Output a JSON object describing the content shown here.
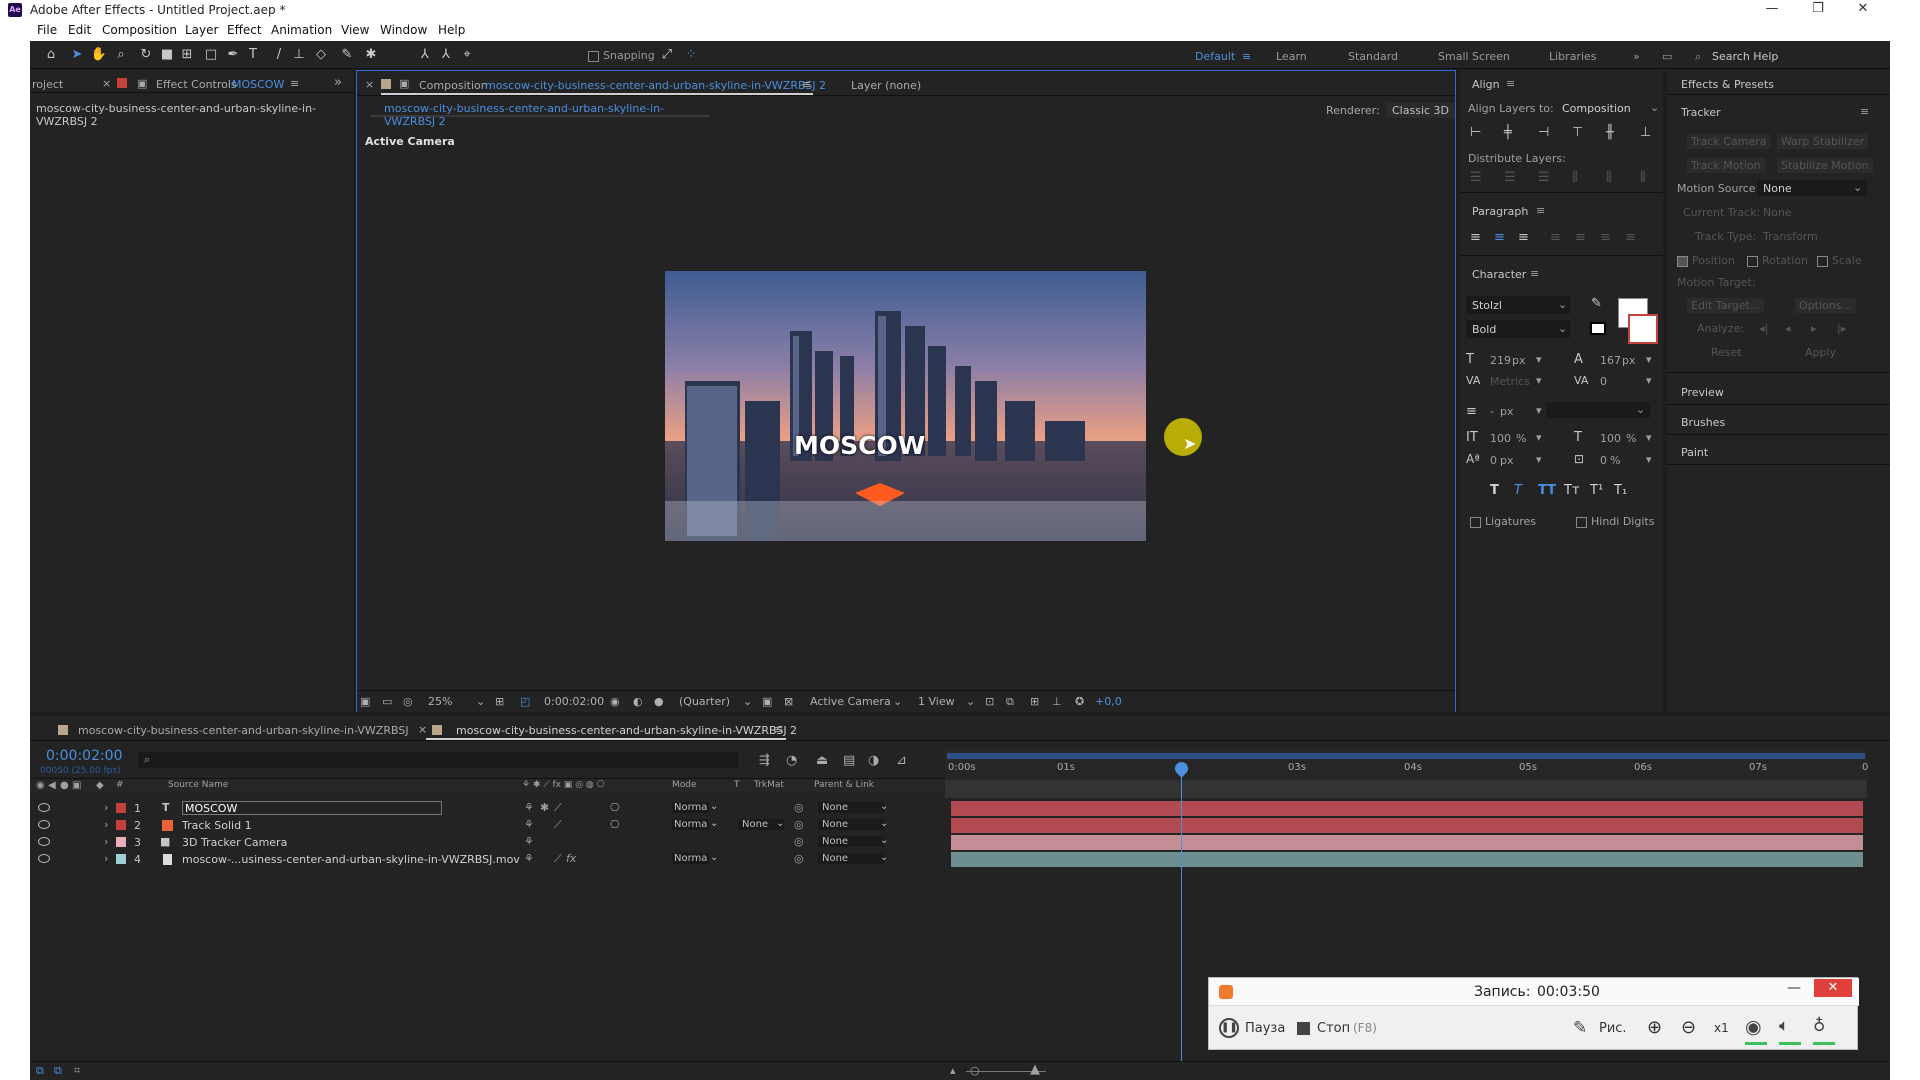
{
  "window": {
    "title": "Adobe After Effects - Untitled Project.aep *",
    "app_icon": "Ae",
    "controls": [
      "minimize-icon",
      "restore-icon",
      "close-icon"
    ]
  },
  "menu": [
    "File",
    "Edit",
    "Composition",
    "Layer",
    "Effect",
    "Animation",
    "View",
    "Window",
    "Help"
  ],
  "toolbar": {
    "snapping_label": "Snapping",
    "workspaces": [
      "Default",
      "Learn",
      "Standard",
      "Small Screen",
      "Libraries"
    ],
    "search_help": "Search Help"
  },
  "project_panel": {
    "tab_project": "roject",
    "tab_effect_controls": "Effect Controls",
    "effect_controls_layer": "MOSCOW",
    "item": "moscow-city-business-center-and-urban-skyline-in-VWZRBSJ 2"
  },
  "composition_panel": {
    "tab_prefix": "Composition",
    "comp_name": "moscow-city-business-center-and-urban-skyline-in-VWZRBSJ 2",
    "layer_tab": "Layer (none)",
    "breadcrumb": "moscow-city-business-center-and-urban-skyline-in-VWZRBSJ 2",
    "renderer_label": "Renderer:",
    "renderer_value": "Classic 3D",
    "view_label": "Active Camera",
    "overlay_text": "MOSCOW",
    "zoom": "25%",
    "timecode": "0:00:02:00",
    "resolution": "(Quarter)",
    "camera": "Active Camera",
    "views": "1 View",
    "exposure": "+0,0"
  },
  "align_panel": {
    "title": "Align",
    "align_layers_to_label": "Align Layers to:",
    "align_layers_to_value": "Composition",
    "distribute_label": "Distribute Layers:"
  },
  "paragraph_panel": {
    "title": "Paragraph"
  },
  "character_panel": {
    "title": "Character",
    "font": "Stolzl",
    "style": "Bold",
    "size": "219",
    "size_unit": "px",
    "leading": "167",
    "leading_unit": "px",
    "kerning": "Metrics",
    "tracking": "0",
    "stroke_width": "-",
    "stroke_unit": "px",
    "vertical_scale": "100",
    "horizontal_scale": "100",
    "baseline_shift": "0",
    "tsume": "0",
    "percent": "%",
    "style_buttons": [
      "T",
      "T",
      "TT",
      "Tт",
      "T¹",
      "T₁"
    ],
    "ligatures": "Ligatures",
    "hindi_digits": "Hindi Digits"
  },
  "right_panel": {
    "effects_presets": "Effects & Presets",
    "tracker": "Tracker",
    "track_camera": "Track Camera",
    "warp_stabilizer": "Warp Stabilizer",
    "track_motion": "Track Motion",
    "stabilize_motion": "Stabilize Motion",
    "motion_source_label": "Motion Source:",
    "motion_source_value": "None",
    "current_track_label": "Current Track:",
    "current_track_value": "None",
    "track_type_label": "Track Type:",
    "track_type_value": "Transform",
    "position": "Position",
    "rotation": "Rotation",
    "scale": "Scale",
    "motion_target": "Motion Target:",
    "edit_target": "Edit Target...",
    "options": "Options...",
    "analyze": "Analyze:",
    "reset": "Reset",
    "apply": "Apply",
    "preview": "Preview",
    "brushes": "Brushes",
    "paint": "Paint"
  },
  "timeline": {
    "tab1": "moscow-city-business-center-and-urban-skyline-in-VWZRBSJ",
    "tab2": "moscow-city-business-center-and-urban-skyline-in-VWZRBSJ 2",
    "timecode": "0:00:02:00",
    "fps": "00050 (25.00 fps)",
    "headers": {
      "num": "#",
      "source": "Source Name",
      "mode": "Mode",
      "t": "T",
      "trkmat": "TrkMat",
      "parent": "Parent & Link"
    },
    "ruler": [
      "0:00s",
      "01s",
      "03s",
      "04s",
      "05s",
      "06s",
      "07s",
      "0"
    ],
    "layers": [
      {
        "num": "1",
        "name": "MOSCOW",
        "type_icon": "text-layer-icon",
        "color": "#c4413c",
        "mode": "Norma",
        "trkmat": "",
        "parent": "None",
        "bar_color": "#b14a51"
      },
      {
        "num": "2",
        "name": "Track Solid 1",
        "type_icon": "solid-layer-icon",
        "color": "#c4413c",
        "mode": "Norma",
        "trkmat": "None",
        "parent": "None",
        "bar_color": "#b14a51"
      },
      {
        "num": "3",
        "name": "3D Tracker Camera",
        "type_icon": "camera-layer-icon",
        "color": "#e8b0b9",
        "mode": "",
        "trkmat": "",
        "parent": "None",
        "bar_color": "#c38e95"
      },
      {
        "num": "4",
        "name": "moscow-...usiness-center-and-urban-skyline-in-VWZRBSJ.mov",
        "type_icon": "footage-layer-icon",
        "color": "#9fcfd2",
        "mode": "Norma",
        "trkmat": "",
        "parent": "None",
        "bar_color": "#6e8f8f"
      }
    ]
  },
  "recorder": {
    "record_label": "Запись:",
    "record_time": "00:03:50",
    "pause": "Пауза",
    "stop": "Стоп",
    "stop_key": "(F8)",
    "draw": "Рис.",
    "zoom": "x1"
  },
  "colors": {
    "accent": "#2d6ad1",
    "timecode": "#4a8fe0",
    "panel_bg": "#232323",
    "cursor_highlight": "#d4c400"
  }
}
